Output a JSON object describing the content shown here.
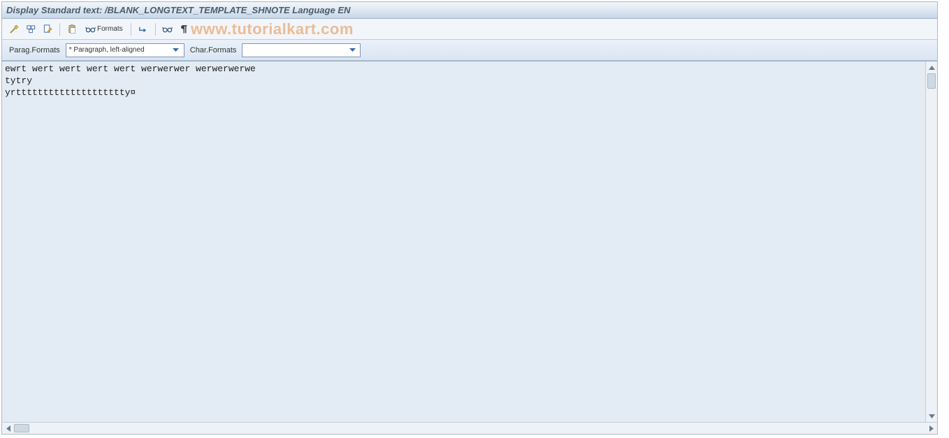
{
  "title": "Display Standard text: /BLANK_LONGTEXT_TEMPLATE_SHNOTE Language EN",
  "watermark": "www.tutorialkart.com",
  "toolbar": {
    "formats_label": "Formats"
  },
  "format_bar": {
    "parag_label": "Parag.Formats",
    "parag_selected": "* Paragraph, left-aligned",
    "char_label": "Char.Formats",
    "char_selected": ""
  },
  "editor": {
    "lines": [
      "ewrt wert wert wert wert werwerwer werwerwerwe",
      "tytry",
      "yrtttttttttttttttttttty¤"
    ]
  }
}
